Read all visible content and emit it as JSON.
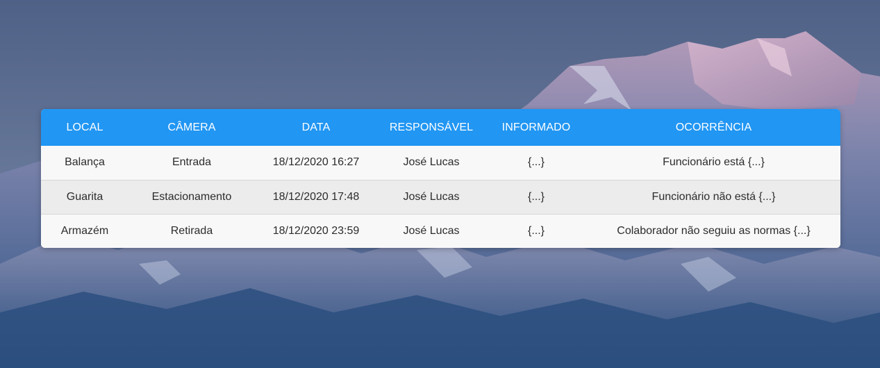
{
  "table": {
    "headers": [
      "LOCAL",
      "CÂMERA",
      "DATA",
      "RESPONSÁVEL",
      "INFORMADO",
      "OCORRÊNCIA"
    ],
    "rows": [
      [
        "Balança",
        "Entrada",
        "18/12/2020 16:27",
        "José Lucas",
        "{...}",
        "Funcionário está {...}"
      ],
      [
        "Guarita",
        "Estacionamento",
        "18/12/2020 17:48",
        "José Lucas",
        "{...}",
        "Funcionário não está {...}"
      ],
      [
        "Armazém",
        "Retirada",
        "18/12/2020 23:59",
        "José Lucas",
        "{...}",
        "Colaborador não seguiu as normas {...}"
      ]
    ]
  },
  "colors": {
    "header_bg": "#2196f3",
    "sky": "#5a6d8f",
    "mountain_light": "#c7a9c9"
  }
}
